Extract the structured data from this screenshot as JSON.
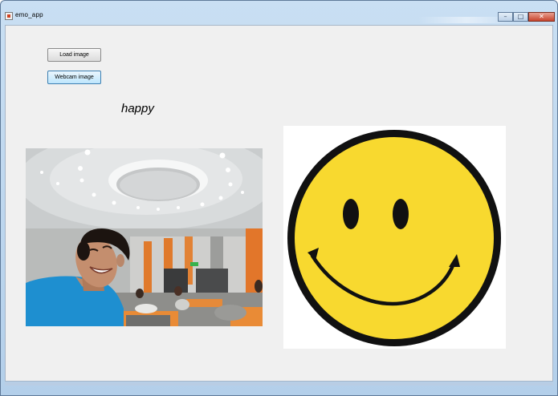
{
  "window": {
    "title": "emo_app",
    "controls": [
      "minimize",
      "maximize",
      "close"
    ]
  },
  "buttons": {
    "load_label": "Load image",
    "webcam_label": "Webcam image"
  },
  "result": {
    "emotion": "happy"
  },
  "images": {
    "photo_icon": "webcam-photo",
    "emoji_icon": "smiley-face-icon"
  },
  "colors": {
    "smiley_fill": "#f8d92f",
    "smiley_outline": "#111111",
    "panel_bg": "#f0f0f0",
    "shirt": "#1e8fd0"
  }
}
